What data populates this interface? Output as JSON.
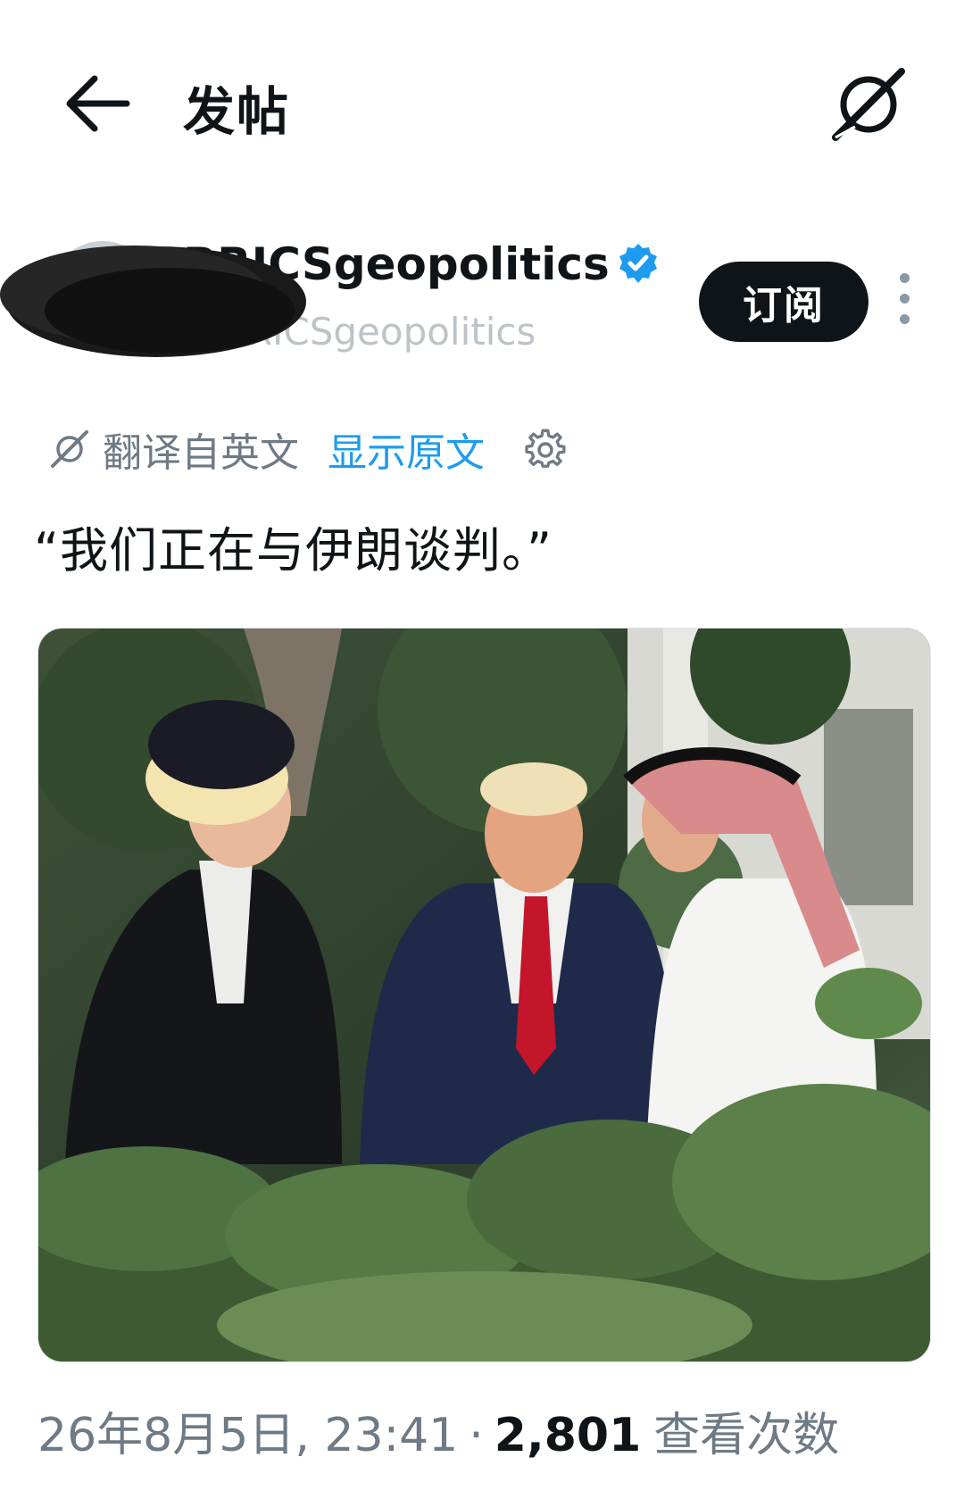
{
  "header": {
    "back_icon": "arrow-left-icon",
    "title": "发帖",
    "grok_icon": "grok-slash-icon"
  },
  "author": {
    "display_name": "BRICSgeopolitics",
    "verified_icon": "verified-badge-icon",
    "handle": "@BRICSgeopolitics",
    "subscribe_label": "订阅",
    "more_icon": "more-vertical-icon"
  },
  "translation": {
    "icon": "grok-slash-icon",
    "label": "翻译自英文",
    "show_original": "显示原文",
    "settings_icon": "gear-icon"
  },
  "post": {
    "text": "“我们正在与伊朗谈判。”",
    "image_alt": "三名男子在花园中交谈"
  },
  "footer": {
    "datetime": "26年8月5日, 23:41",
    "separator": "·",
    "views": "2,801",
    "views_label": "查看次数"
  },
  "colors": {
    "accent": "#1d9bf0",
    "text": "#0f1419",
    "muted": "#6e7a85",
    "button_bg": "#0f1419"
  }
}
